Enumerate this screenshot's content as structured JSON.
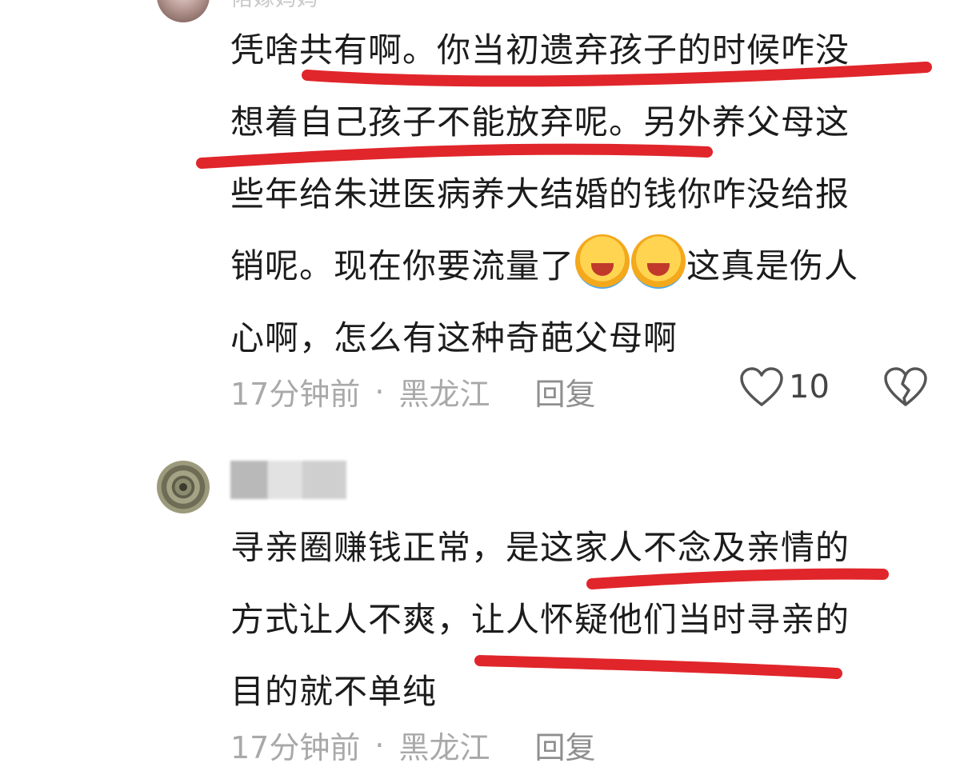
{
  "comments": [
    {
      "username": "陪嫁妈妈",
      "lines": [
        "凭啥共有啊。你当初遗弃孩子的时候咋没",
        "想着自己孩子不能放弃呢。另外养父母这",
        "些年给朱进医病养大结婚的钱你咋没给报",
        "销呢。现在你要流量了",
        "这真是伤人",
        "心啊，怎么有这种奇葩父母啊"
      ],
      "time": "17分钟前",
      "location": "黑龙江",
      "reply_label": "回复",
      "like_count": "10"
    },
    {
      "lines": [
        "寻亲圈赚钱正常，是这家人不念及亲情的",
        "方式让人不爽，让人怀疑他们当时寻亲的",
        "目的就不单纯"
      ],
      "time": "17分钟前",
      "location": "黑龙江",
      "reply_label": "回复"
    }
  ],
  "separator": "·",
  "icons": {
    "like": "heart-outline-icon",
    "dislike": "broken-heart-icon",
    "emoji": "facepalm-laugh-cry-emoji"
  },
  "colors": {
    "annotation_red": "#e0262b",
    "meta_gray": "#a9a9a9"
  }
}
